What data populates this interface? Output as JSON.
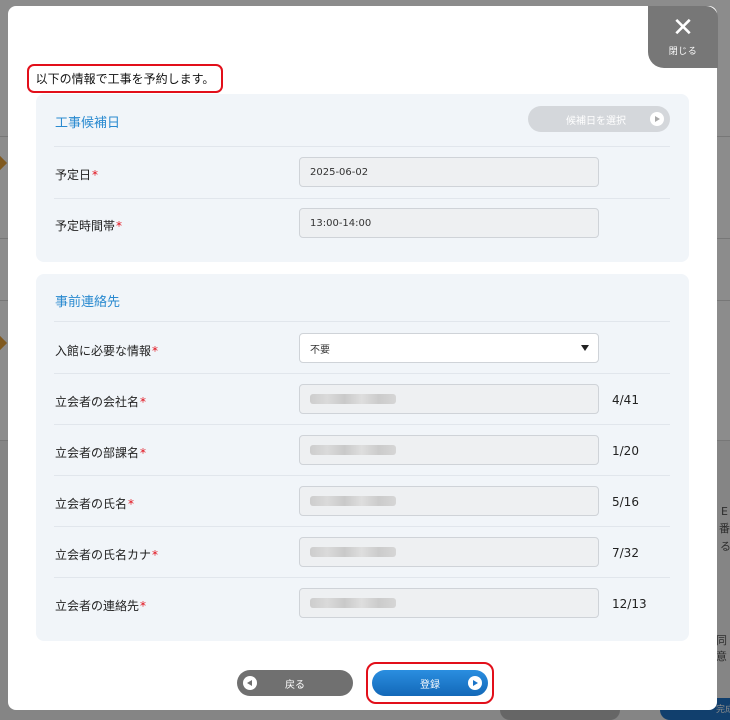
{
  "background": {
    "side_texts": [
      "E",
      "番",
      "る",
      "同意",
      "完成"
    ]
  },
  "modal": {
    "close_label": "閉じる",
    "close_symbol": "✕",
    "intro": "以下の情報で工事を予約します。"
  },
  "schedule": {
    "title": "工事候補日",
    "select_date_button": "候補日を選択",
    "rows": [
      {
        "label": "予定日",
        "required": "*",
        "value": "2025-06-02"
      },
      {
        "label": "予定時間帯",
        "required": "*",
        "value": "13:00-14:00"
      }
    ]
  },
  "contact": {
    "title": "事前連絡先",
    "entry_info": {
      "label": "入館に必要な情報",
      "required": "*",
      "value": "不要"
    },
    "rows": [
      {
        "label": "立会者の会社名",
        "required": "*",
        "counter": "4/41"
      },
      {
        "label": "立会者の部課名",
        "required": "*",
        "counter": "1/20"
      },
      {
        "label": "立会者の氏名",
        "required": "*",
        "counter": "5/16"
      },
      {
        "label": "立会者の氏名カナ",
        "required": "*",
        "counter": "7/32"
      },
      {
        "label": "立会者の連絡先",
        "required": "*",
        "counter": "12/13"
      }
    ]
  },
  "footer": {
    "back_label": "戻る",
    "register_label": "登録"
  },
  "colors": {
    "accent_blue": "#2a8ad0",
    "required_red": "#e20f1a",
    "highlight_red": "#e20f1a",
    "close_gray": "#777777",
    "back_gray": "#707070",
    "panel_bg": "#f1f5f9"
  },
  "icons": {
    "close": "close-icon",
    "play": "play-circle-icon",
    "back": "back-circle-icon",
    "dropdown": "caret-down-icon"
  }
}
